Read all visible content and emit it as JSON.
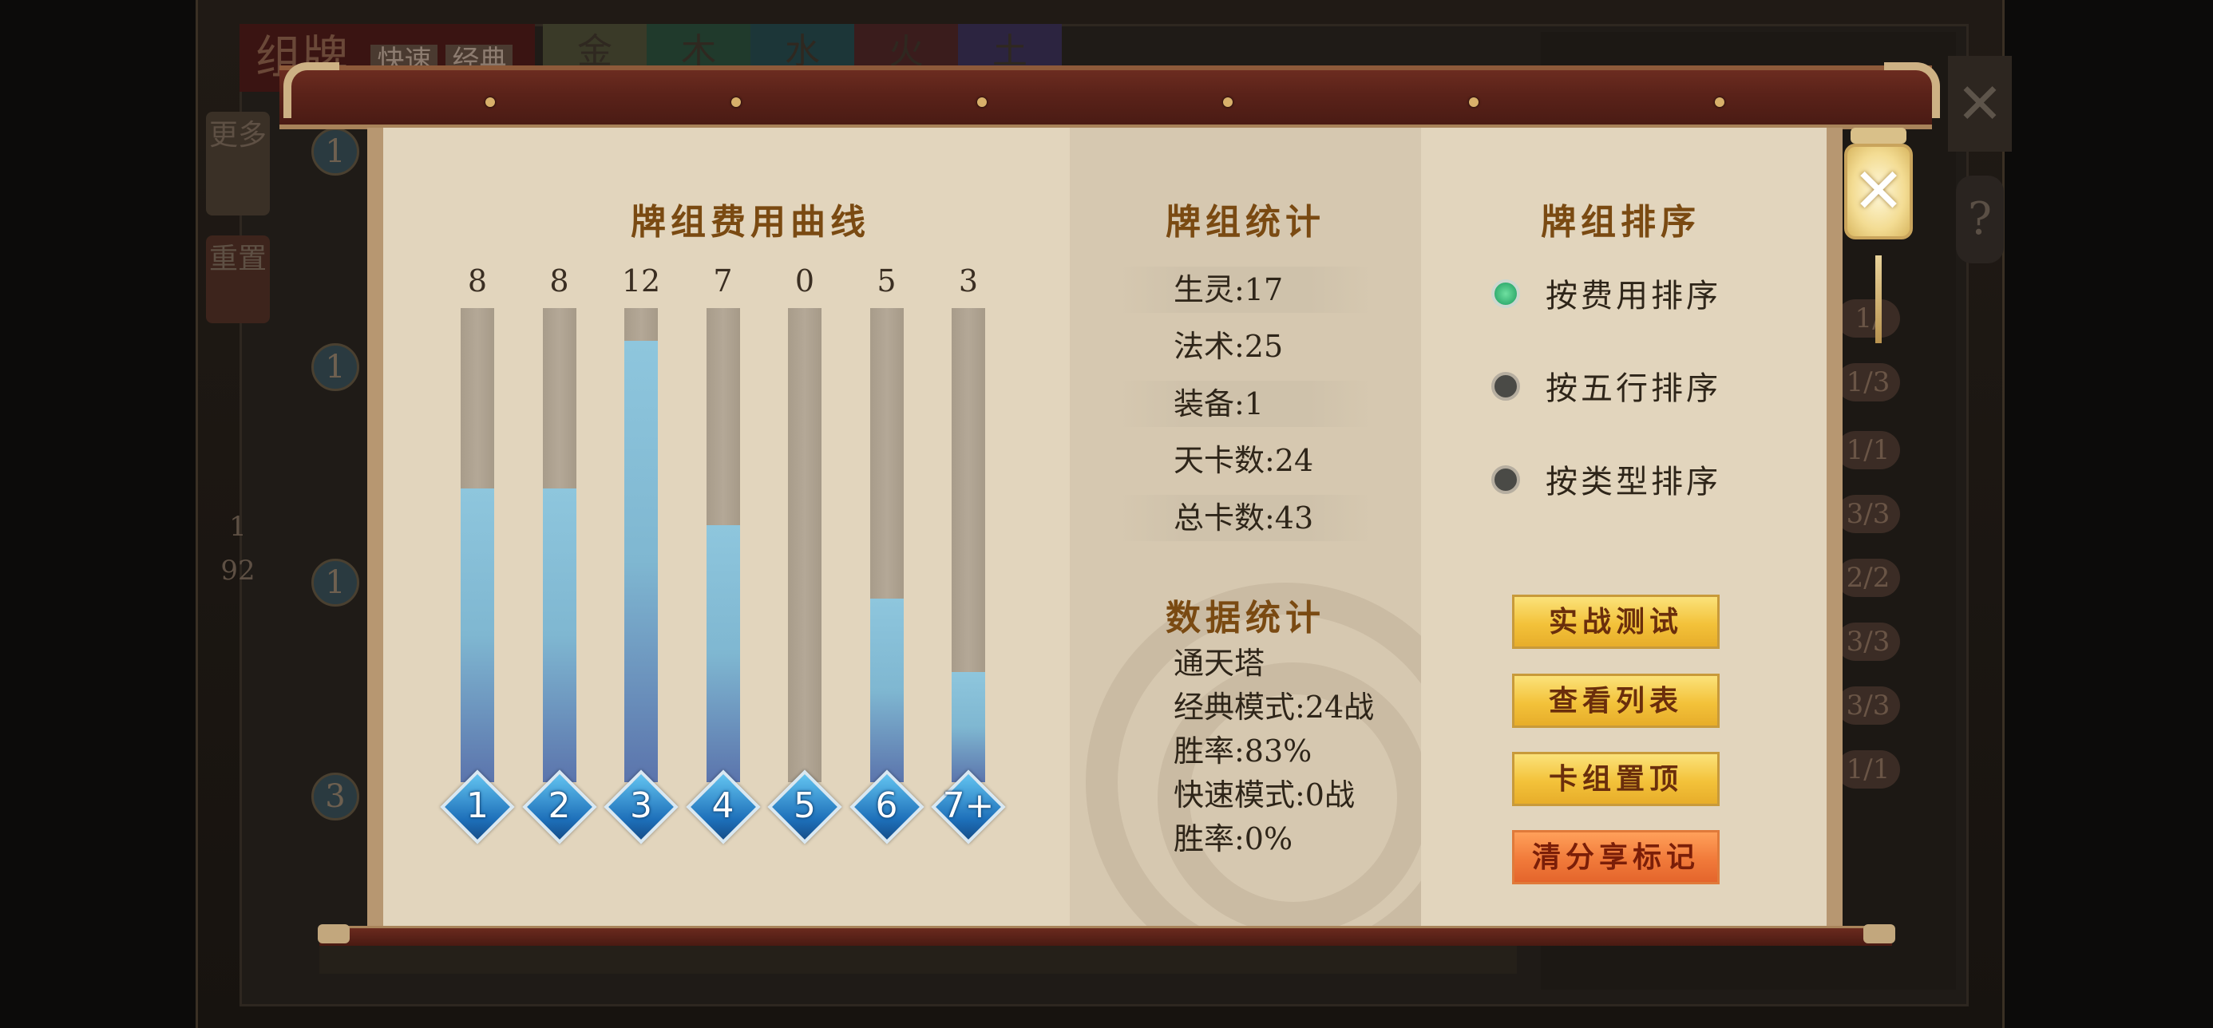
{
  "background": {
    "title": "组牌",
    "modes": [
      "快速",
      "经典"
    ],
    "element_tabs": [
      "金",
      "木",
      "水",
      "火",
      "土"
    ],
    "side_buttons": [
      "更多",
      "重置"
    ],
    "cost_coins": [
      "1",
      "1",
      "1",
      "3"
    ],
    "page_indicator": [
      "1",
      "92"
    ],
    "right_pills": [
      "1/",
      "1/3",
      "1/1",
      "3/3",
      "2/2",
      "3/3",
      "3/3",
      "1/1"
    ],
    "close_label": "✕",
    "help_label": "?"
  },
  "cost_curve": {
    "title": "牌组费用曲线",
    "chart_data": {
      "type": "bar",
      "title": "牌组费用曲线",
      "categories": [
        "1",
        "2",
        "3",
        "4",
        "5",
        "6",
        "7+"
      ],
      "values": [
        8,
        8,
        12,
        7,
        0,
        5,
        3
      ],
      "ylim": [
        0,
        12.9
      ]
    }
  },
  "deck_stats": {
    "title": "牌组统计",
    "rows": [
      "生灵:17",
      "法术:25",
      "装备:1",
      "天卡数:24",
      "总卡数:43"
    ]
  },
  "data_stats": {
    "title": "数据统计",
    "lines": [
      "通天塔",
      "经典模式:24战",
      "胜率:83%",
      "快速模式:0战",
      "胜率:0%"
    ]
  },
  "deck_sort": {
    "title": "牌组排序",
    "options": [
      {
        "label": "按费用排序",
        "selected": true
      },
      {
        "label": "按五行排序",
        "selected": false
      },
      {
        "label": "按类型排序",
        "selected": false
      }
    ]
  },
  "buttons": [
    "实战测试",
    "查看列表",
    "卡组置顶",
    "清分享标记"
  ],
  "colors": {
    "panel": "#e2d5bd",
    "title_brown": "#7a4a12",
    "bar_fill": "#7fb7d1",
    "gem_blue": "#1d6fb9",
    "radio_on": "#1a9a5e",
    "button_gold": "#f3c23a",
    "button_orange": "#f17a3a"
  },
  "icons": {
    "lantern_close": "close-icon",
    "cost_gem": "diamond-gem-icon",
    "radio": "radio-dot-icon"
  }
}
